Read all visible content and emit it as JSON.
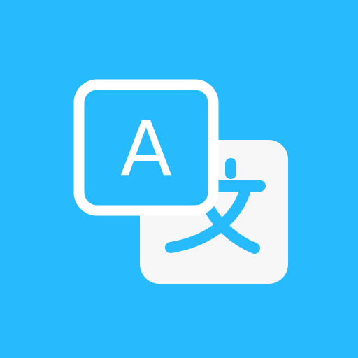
{
  "icon": {
    "name": "translate-app-icon",
    "colors": {
      "background": "#27BAFD",
      "foreground": "#FFFFFF",
      "secondary_card": "#F7F7F7"
    },
    "source_glyph": "A",
    "target_glyph": "文"
  }
}
